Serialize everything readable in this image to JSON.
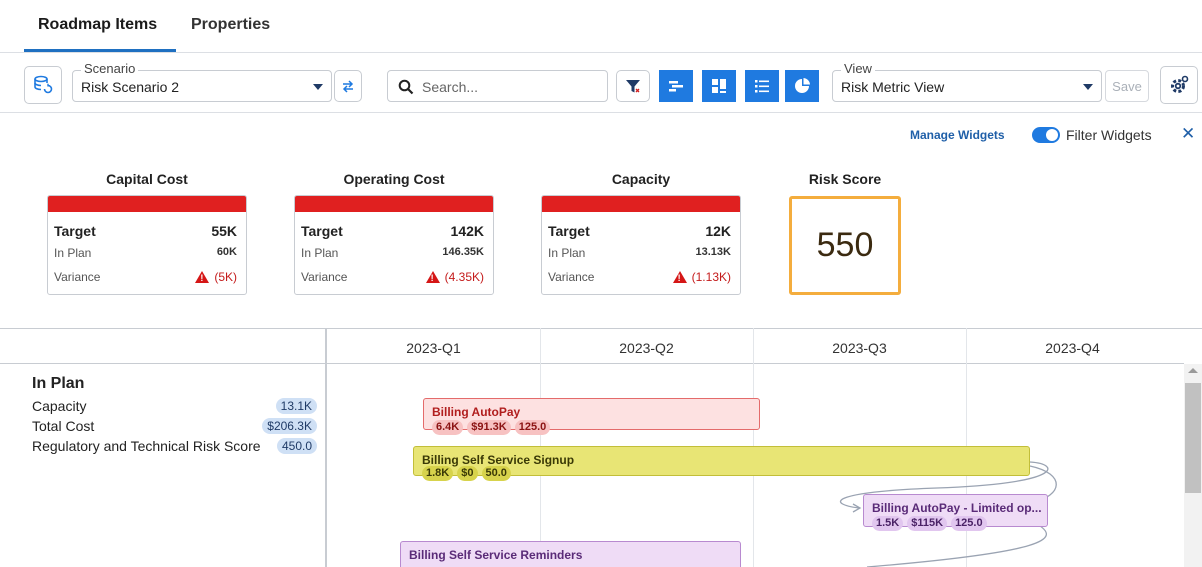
{
  "tabs": [
    {
      "label": "Roadmap Items",
      "active": true
    },
    {
      "label": "Properties",
      "active": false
    }
  ],
  "toolbar": {
    "scenario_icon": "database-refresh-icon",
    "scenario_legend": "Scenario",
    "scenario_value": "Risk Scenario 2",
    "compare_icon": "swap-arrows-icon",
    "search_placeholder": "Search...",
    "filter_icon": "filter-icon",
    "view_buttons": [
      {
        "icon": "gantt-icon",
        "active": true
      },
      {
        "icon": "board-icon",
        "active": true
      },
      {
        "icon": "list-icon",
        "active": true
      },
      {
        "icon": "pie-chart-icon",
        "active": true
      }
    ],
    "view_legend": "View",
    "view_value": "Risk Metric View",
    "save_label": "Save",
    "settings_icon": "gear-icon"
  },
  "widgets_header": {
    "manage_label": "Manage Widgets",
    "filter_label": "Filter Widgets",
    "filter_on": true,
    "close_label": "✕"
  },
  "widgets": [
    {
      "title": "Capital Cost",
      "target_label": "Target",
      "target": "55K",
      "inplan_label": "In Plan",
      "inplan": "60K",
      "variance_label": "Variance",
      "variance": "(5K)"
    },
    {
      "title": "Operating Cost",
      "target_label": "Target",
      "target": "142K",
      "inplan_label": "In Plan",
      "inplan": "146.35K",
      "variance_label": "Variance",
      "variance": "(4.35K)"
    },
    {
      "title": "Capacity",
      "target_label": "Target",
      "target": "12K",
      "inplan_label": "In Plan",
      "inplan": "13.13K",
      "variance_label": "Variance",
      "variance": "(1.13K)"
    }
  ],
  "risk_score": {
    "title": "Risk Score",
    "value": "550"
  },
  "timeline": {
    "quarters": [
      "2023-Q1",
      "2023-Q2",
      "2023-Q3",
      "2023-Q4"
    ],
    "in_plan": {
      "title": "In Plan",
      "metrics": [
        {
          "label": "Capacity",
          "value": "13.1K"
        },
        {
          "label": "Total Cost",
          "value": "$206.3K"
        },
        {
          "label": "Regulatory and Technical Risk Score",
          "value": "450.0"
        }
      ]
    },
    "items": [
      {
        "name": "Billing AutoPay",
        "chips": [
          "6.4K",
          "$91.3K",
          "125.0"
        ],
        "color": "red"
      },
      {
        "name": "Billing Self Service Signup",
        "chips": [
          "1.8K",
          "$0",
          "50.0"
        ],
        "color": "yellow"
      },
      {
        "name": "Billing AutoPay - Limited op...",
        "chips": [
          "1.5K",
          "$115K",
          "125.0"
        ],
        "color": "purple"
      },
      {
        "name": "Billing Self Service Reminders",
        "chips": [],
        "color": "purple"
      }
    ]
  },
  "colors": {
    "accent": "#1f7ae0",
    "alert": "#e02020",
    "risk_border": "#f4ad3d"
  }
}
